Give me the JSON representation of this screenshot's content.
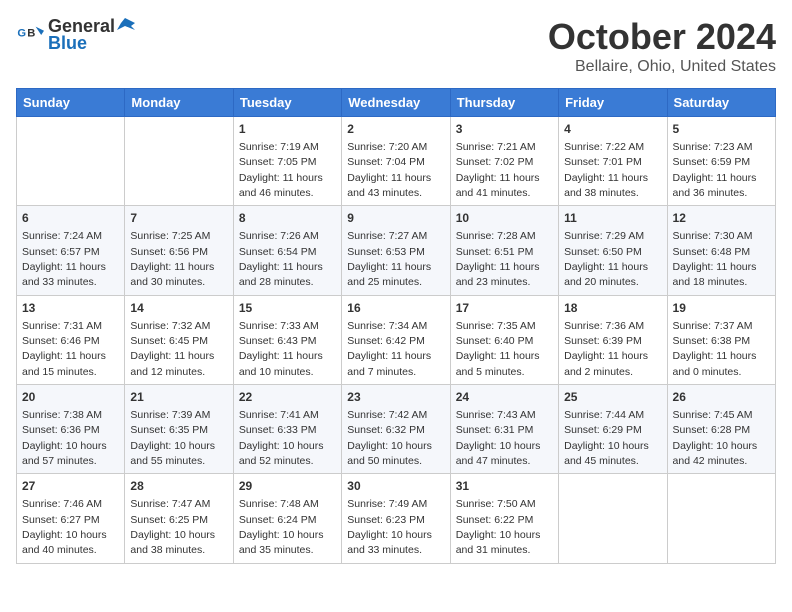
{
  "header": {
    "logo_line1": "General",
    "logo_line2": "Blue",
    "month": "October 2024",
    "location": "Bellaire, Ohio, United States"
  },
  "days_of_week": [
    "Sunday",
    "Monday",
    "Tuesday",
    "Wednesday",
    "Thursday",
    "Friday",
    "Saturday"
  ],
  "weeks": [
    [
      {
        "day": "",
        "info": ""
      },
      {
        "day": "",
        "info": ""
      },
      {
        "day": "1",
        "info": "Sunrise: 7:19 AM\nSunset: 7:05 PM\nDaylight: 11 hours and 46 minutes."
      },
      {
        "day": "2",
        "info": "Sunrise: 7:20 AM\nSunset: 7:04 PM\nDaylight: 11 hours and 43 minutes."
      },
      {
        "day": "3",
        "info": "Sunrise: 7:21 AM\nSunset: 7:02 PM\nDaylight: 11 hours and 41 minutes."
      },
      {
        "day": "4",
        "info": "Sunrise: 7:22 AM\nSunset: 7:01 PM\nDaylight: 11 hours and 38 minutes."
      },
      {
        "day": "5",
        "info": "Sunrise: 7:23 AM\nSunset: 6:59 PM\nDaylight: 11 hours and 36 minutes."
      }
    ],
    [
      {
        "day": "6",
        "info": "Sunrise: 7:24 AM\nSunset: 6:57 PM\nDaylight: 11 hours and 33 minutes."
      },
      {
        "day": "7",
        "info": "Sunrise: 7:25 AM\nSunset: 6:56 PM\nDaylight: 11 hours and 30 minutes."
      },
      {
        "day": "8",
        "info": "Sunrise: 7:26 AM\nSunset: 6:54 PM\nDaylight: 11 hours and 28 minutes."
      },
      {
        "day": "9",
        "info": "Sunrise: 7:27 AM\nSunset: 6:53 PM\nDaylight: 11 hours and 25 minutes."
      },
      {
        "day": "10",
        "info": "Sunrise: 7:28 AM\nSunset: 6:51 PM\nDaylight: 11 hours and 23 minutes."
      },
      {
        "day": "11",
        "info": "Sunrise: 7:29 AM\nSunset: 6:50 PM\nDaylight: 11 hours and 20 minutes."
      },
      {
        "day": "12",
        "info": "Sunrise: 7:30 AM\nSunset: 6:48 PM\nDaylight: 11 hours and 18 minutes."
      }
    ],
    [
      {
        "day": "13",
        "info": "Sunrise: 7:31 AM\nSunset: 6:46 PM\nDaylight: 11 hours and 15 minutes."
      },
      {
        "day": "14",
        "info": "Sunrise: 7:32 AM\nSunset: 6:45 PM\nDaylight: 11 hours and 12 minutes."
      },
      {
        "day": "15",
        "info": "Sunrise: 7:33 AM\nSunset: 6:43 PM\nDaylight: 11 hours and 10 minutes."
      },
      {
        "day": "16",
        "info": "Sunrise: 7:34 AM\nSunset: 6:42 PM\nDaylight: 11 hours and 7 minutes."
      },
      {
        "day": "17",
        "info": "Sunrise: 7:35 AM\nSunset: 6:40 PM\nDaylight: 11 hours and 5 minutes."
      },
      {
        "day": "18",
        "info": "Sunrise: 7:36 AM\nSunset: 6:39 PM\nDaylight: 11 hours and 2 minutes."
      },
      {
        "day": "19",
        "info": "Sunrise: 7:37 AM\nSunset: 6:38 PM\nDaylight: 11 hours and 0 minutes."
      }
    ],
    [
      {
        "day": "20",
        "info": "Sunrise: 7:38 AM\nSunset: 6:36 PM\nDaylight: 10 hours and 57 minutes."
      },
      {
        "day": "21",
        "info": "Sunrise: 7:39 AM\nSunset: 6:35 PM\nDaylight: 10 hours and 55 minutes."
      },
      {
        "day": "22",
        "info": "Sunrise: 7:41 AM\nSunset: 6:33 PM\nDaylight: 10 hours and 52 minutes."
      },
      {
        "day": "23",
        "info": "Sunrise: 7:42 AM\nSunset: 6:32 PM\nDaylight: 10 hours and 50 minutes."
      },
      {
        "day": "24",
        "info": "Sunrise: 7:43 AM\nSunset: 6:31 PM\nDaylight: 10 hours and 47 minutes."
      },
      {
        "day": "25",
        "info": "Sunrise: 7:44 AM\nSunset: 6:29 PM\nDaylight: 10 hours and 45 minutes."
      },
      {
        "day": "26",
        "info": "Sunrise: 7:45 AM\nSunset: 6:28 PM\nDaylight: 10 hours and 42 minutes."
      }
    ],
    [
      {
        "day": "27",
        "info": "Sunrise: 7:46 AM\nSunset: 6:27 PM\nDaylight: 10 hours and 40 minutes."
      },
      {
        "day": "28",
        "info": "Sunrise: 7:47 AM\nSunset: 6:25 PM\nDaylight: 10 hours and 38 minutes."
      },
      {
        "day": "29",
        "info": "Sunrise: 7:48 AM\nSunset: 6:24 PM\nDaylight: 10 hours and 35 minutes."
      },
      {
        "day": "30",
        "info": "Sunrise: 7:49 AM\nSunset: 6:23 PM\nDaylight: 10 hours and 33 minutes."
      },
      {
        "day": "31",
        "info": "Sunrise: 7:50 AM\nSunset: 6:22 PM\nDaylight: 10 hours and 31 minutes."
      },
      {
        "day": "",
        "info": ""
      },
      {
        "day": "",
        "info": ""
      }
    ]
  ]
}
